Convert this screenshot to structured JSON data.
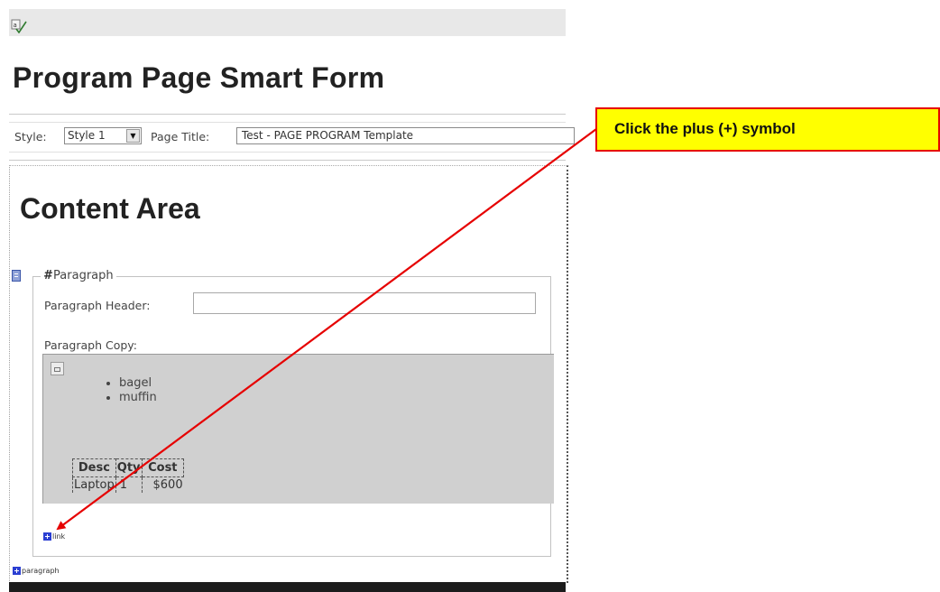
{
  "toolbar": {
    "icon": "spellcheck-icon"
  },
  "form": {
    "title": "Program Page Smart Form",
    "style_label": "Style:",
    "style_value": "Style 1",
    "page_title_label": "Page Title:",
    "page_title_value": "Test - PAGE PROGRAM Template"
  },
  "content": {
    "title": "Content Area",
    "paragraph": {
      "legend": "Paragraph",
      "legend_icon": "#",
      "header_label": "Paragraph Header:",
      "header_value": "",
      "copy_label": "Paragraph Copy:",
      "bullets": [
        "bagel",
        "muffin"
      ],
      "table": {
        "headers": [
          "Desc",
          "Qty",
          "Cost"
        ],
        "rows": [
          [
            "Laptop",
            "1",
            "$600"
          ]
        ]
      },
      "add_link_label": "link"
    },
    "add_paragraph_label": "paragraph"
  },
  "callout": {
    "text": "Click the plus (+) symbol",
    "background": "#ffff00",
    "border": "#e60000",
    "arrow_color": "#e60000"
  }
}
